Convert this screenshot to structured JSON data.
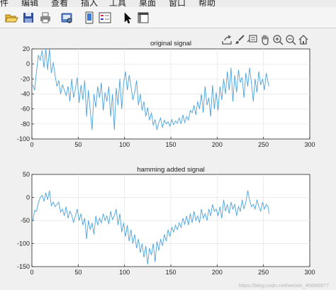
{
  "menubar": {
    "items": [
      "件",
      "编辑",
      "查看",
      "插入",
      "工具",
      "桌面",
      "窗口",
      "帮助"
    ]
  },
  "toolbar": {
    "buttons": [
      "open-file-icon",
      "save-icon",
      "print-icon",
      "print-preview-icon",
      "dock-icon",
      "legend-icon",
      "cursor-icon",
      "property-editor-icon"
    ]
  },
  "axes_toolbar": {
    "buttons": [
      "export-icon",
      "brush-icon",
      "data-tips-icon",
      "pan-hand-icon",
      "zoom-in-icon",
      "zoom-out-icon",
      "home-icon"
    ]
  },
  "colors": {
    "line": "#4aa3dc",
    "axes_bg": "#ffffff",
    "figure_bg": "#f0f0f0",
    "grid": "#e3e3e3"
  },
  "watermark": "https://blog.csdn.net/weixin_45696977",
  "chart_data": [
    {
      "type": "line",
      "title": "original signal",
      "xlim": [
        0,
        300
      ],
      "ylim": [
        -100,
        20
      ],
      "xticks": [
        0,
        50,
        100,
        150,
        200,
        250,
        300
      ],
      "yticks": [
        -100,
        -80,
        -60,
        -40,
        -20,
        0,
        20
      ],
      "grid": true,
      "series": [
        {
          "x": [
            1,
            3,
            5,
            7,
            9,
            11,
            13,
            15,
            17,
            19,
            21,
            23,
            25,
            27,
            29,
            31,
            33,
            35,
            37,
            39,
            41,
            43,
            45,
            47,
            49,
            51,
            53,
            55,
            57,
            59,
            61,
            63,
            65,
            67,
            69,
            71,
            73,
            75,
            77,
            79,
            81,
            83,
            85,
            87,
            89,
            91,
            93,
            95,
            97,
            99,
            101,
            103,
            105,
            107,
            109,
            111,
            113,
            115,
            117,
            119,
            121,
            123,
            125,
            127,
            129,
            131,
            133,
            135,
            137,
            139,
            141,
            143,
            145,
            147,
            149,
            151,
            153,
            155,
            157,
            159,
            161,
            163,
            165,
            167,
            169,
            171,
            173,
            175,
            177,
            179,
            181,
            183,
            185,
            187,
            189,
            191,
            193,
            195,
            197,
            199,
            201,
            203,
            205,
            207,
            209,
            211,
            213,
            215,
            217,
            219,
            221,
            223,
            225,
            227,
            229,
            231,
            233,
            235,
            237,
            239,
            241,
            243,
            245,
            247,
            249,
            251,
            253,
            255,
            256
          ],
          "y": [
            -28,
            -35,
            -10,
            12,
            5,
            18,
            -5,
            20,
            -8,
            22,
            -12,
            2,
            -15,
            -30,
            -22,
            -40,
            -28,
            -35,
            -42,
            -30,
            -50,
            -20,
            -45,
            -33,
            -18,
            -52,
            -28,
            -48,
            -22,
            -70,
            -35,
            -62,
            -88,
            -40,
            -58,
            -30,
            -45,
            -25,
            -62,
            -38,
            -50,
            -30,
            -70,
            -40,
            -88,
            -32,
            -55,
            -20,
            -60,
            -25,
            -10,
            -35,
            -15,
            -30,
            -48,
            -38,
            -22,
            -55,
            -40,
            -62,
            -50,
            -70,
            -58,
            -75,
            -65,
            -82,
            -74,
            -88,
            -78,
            -72,
            -85,
            -75,
            -80,
            -77,
            -83,
            -74,
            -81,
            -76,
            -79,
            -72,
            -80,
            -68,
            -78,
            -70,
            -75,
            -62,
            -65,
            -55,
            -68,
            -50,
            -60,
            -40,
            -65,
            -30,
            -55,
            -45,
            -70,
            -28,
            -60,
            -38,
            -62,
            -30,
            -48,
            -20,
            -40,
            -10,
            -35,
            -5,
            -50,
            -15,
            -38,
            -8,
            -25,
            -18,
            -45,
            -12,
            -30,
            -5,
            -25,
            -50,
            -20,
            -38,
            -10,
            -28,
            -20,
            -35,
            -12,
            -25,
            -30
          ],
          "color": "#4aa3dc"
        }
      ]
    },
    {
      "type": "line",
      "title": "hamming added signal",
      "xlim": [
        0,
        300
      ],
      "ylim": [
        -150,
        50
      ],
      "xticks": [
        0,
        50,
        100,
        150,
        200,
        250,
        300
      ],
      "yticks": [
        -150,
        -100,
        -50,
        0,
        50
      ],
      "grid": true,
      "series": [
        {
          "x": [
            1,
            3,
            5,
            7,
            9,
            11,
            13,
            15,
            17,
            19,
            21,
            23,
            25,
            27,
            29,
            31,
            33,
            35,
            37,
            39,
            41,
            43,
            45,
            47,
            49,
            51,
            53,
            55,
            57,
            59,
            61,
            63,
            65,
            67,
            69,
            71,
            73,
            75,
            77,
            79,
            81,
            83,
            85,
            87,
            89,
            91,
            93,
            95,
            97,
            99,
            101,
            103,
            105,
            107,
            109,
            111,
            113,
            115,
            117,
            119,
            121,
            123,
            125,
            127,
            129,
            131,
            133,
            135,
            137,
            139,
            141,
            143,
            145,
            147,
            149,
            151,
            153,
            155,
            157,
            159,
            161,
            163,
            165,
            167,
            169,
            171,
            173,
            175,
            177,
            179,
            181,
            183,
            185,
            187,
            189,
            191,
            193,
            195,
            197,
            199,
            201,
            203,
            205,
            207,
            209,
            211,
            213,
            215,
            217,
            219,
            221,
            223,
            225,
            227,
            229,
            231,
            233,
            235,
            237,
            239,
            241,
            243,
            245,
            247,
            249,
            251,
            253,
            255,
            256
          ],
          "y": [
            -50,
            -28,
            -30,
            -12,
            0,
            5,
            -8,
            10,
            -5,
            15,
            -18,
            -10,
            -20,
            -15,
            -10,
            -32,
            -25,
            -40,
            -20,
            -45,
            -30,
            -38,
            -55,
            -40,
            -25,
            -50,
            -35,
            -60,
            -45,
            -90,
            -50,
            -70,
            -55,
            -80,
            -40,
            -60,
            -45,
            -55,
            -35,
            -50,
            -40,
            -58,
            -30,
            -48,
            -40,
            -25,
            -60,
            -35,
            -75,
            -55,
            -85,
            -60,
            -95,
            -70,
            -100,
            -80,
            -110,
            -90,
            -120,
            -100,
            -130,
            -105,
            -145,
            -110,
            -125,
            -100,
            -140,
            -95,
            -115,
            -90,
            -105,
            -80,
            -95,
            -70,
            -85,
            -65,
            -75,
            -60,
            -70,
            -55,
            -65,
            -45,
            -58,
            -40,
            -60,
            -35,
            -55,
            -30,
            -50,
            -40,
            -55,
            -25,
            -45,
            -35,
            -50,
            -25,
            -40,
            -15,
            -30,
            -25,
            -40,
            -20,
            -45,
            -5,
            -30,
            -15,
            -35,
            -10,
            -25,
            -15,
            -40,
            -20,
            -30,
            -5,
            -25,
            -10,
            15,
            -5,
            -20,
            -15,
            -25,
            -5,
            -20,
            -30,
            -10,
            -25,
            -15,
            -20,
            -35
          ],
          "color": "#4aa3dc"
        }
      ]
    }
  ]
}
